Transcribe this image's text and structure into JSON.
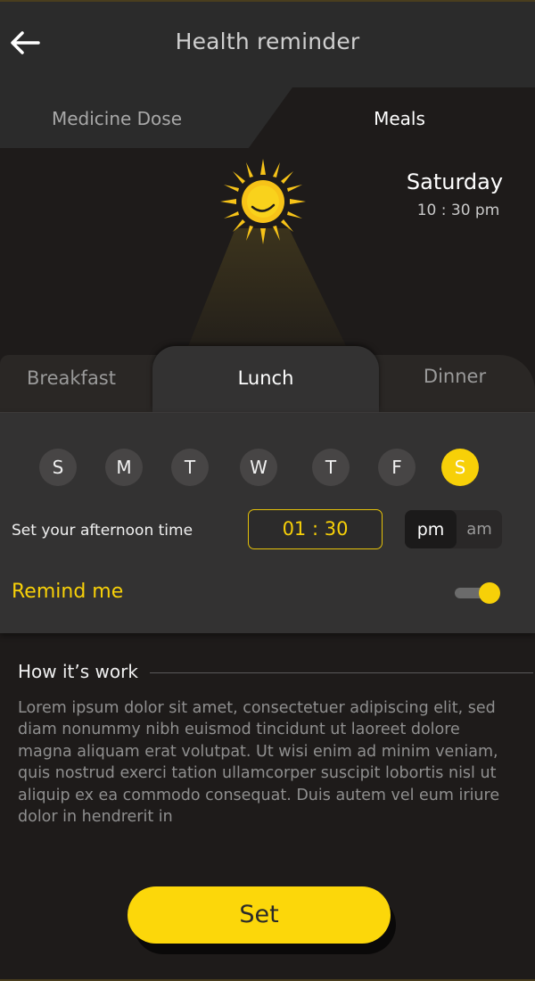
{
  "header": {
    "title": "Health reminder"
  },
  "top_tabs": [
    {
      "label": "Medicine Dose",
      "active": false
    },
    {
      "label": "Meals",
      "active": true
    }
  ],
  "schedule": {
    "day": "Saturday",
    "time": "10 : 30 pm"
  },
  "meal_tabs": [
    {
      "label": "Breakfast",
      "active": false
    },
    {
      "label": "Lunch",
      "active": true
    },
    {
      "label": "Dinner",
      "active": false
    }
  ],
  "days": [
    {
      "label": "S",
      "selected": false
    },
    {
      "label": "M",
      "selected": false
    },
    {
      "label": "T",
      "selected": false
    },
    {
      "label": "W",
      "selected": false
    },
    {
      "label": "T",
      "selected": false
    },
    {
      "label": "F",
      "selected": false
    },
    {
      "label": "S",
      "selected": true
    }
  ],
  "time_setting": {
    "label": "Set your afternoon time",
    "value": "01 : 30",
    "pm_label": "pm",
    "am_label": "am",
    "selected_period": "pm"
  },
  "remind": {
    "label": "Remind me",
    "enabled": true
  },
  "how_it_works": {
    "title": "How it’s work",
    "body": "Lorem ipsum dolor sit amet, consectetuer adipiscing elit, sed diam nonummy nibh euismod tincidunt ut laoreet dolore magna aliquam erat volutpat. Ut wisi enim ad minim veniam, quis nostrud exerci tation ullamcorper suscipit lobortis nisl ut aliquip ex ea commodo consequat. Duis autem vel eum iriure dolor in hendrerit in"
  },
  "set_button": {
    "label": "Set"
  },
  "colors": {
    "accent": "#f7d008",
    "background": "#1e1b1a",
    "panel": "#333232",
    "header": "#2b2b2b"
  },
  "icons": {
    "back": "back-arrow-icon",
    "sun": "sun-icon"
  }
}
